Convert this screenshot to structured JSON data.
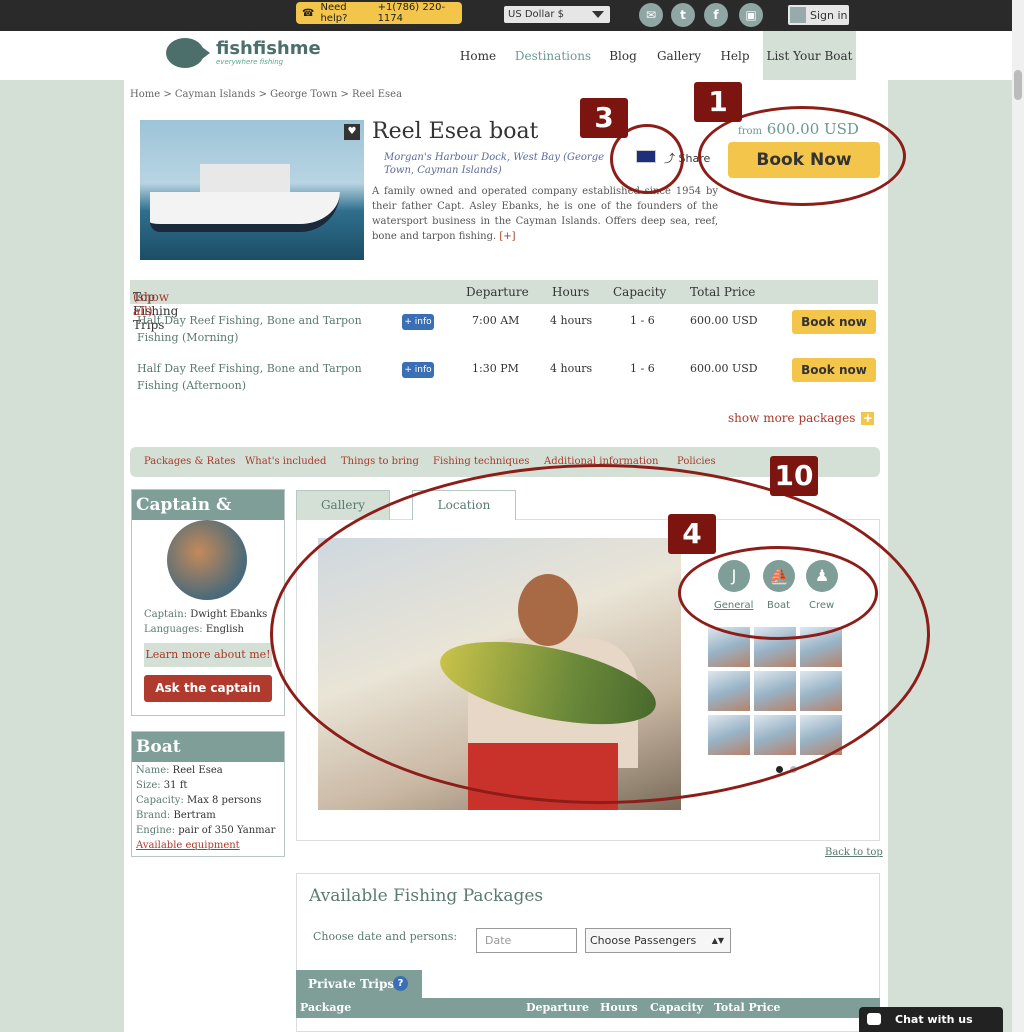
{
  "topbar": {
    "help_label": "Need help?",
    "phone": "+1(786) 220-1174",
    "currency": "US Dollar $",
    "social_icons": [
      "email-icon",
      "twitter-icon",
      "facebook-icon",
      "instagram-icon"
    ],
    "signin": "Sign in"
  },
  "header": {
    "logo_name": "fishfishme",
    "logo_tag": "everywhere fishing",
    "nav": [
      "Home",
      "Destinations",
      "Blog",
      "Gallery",
      "Help",
      "List Your Boat"
    ]
  },
  "breadcrumb": "Home > Cayman Islands > George Town > Reel Esea",
  "listing": {
    "title": "Reel Esea boat",
    "location": "Morgan's Harbour Dock, West Bay (George Town, Cayman Islands)",
    "share": "Share",
    "description": "A family owned and operated company established since 1954 by their father Capt. Asley Ebanks, he is one of the founders of the watersport business in the Cayman Islands. Offers deep sea, reef, bone and tarpon fishing.",
    "more": "[+]",
    "from_label": "from",
    "from_price": "600.00 USD",
    "book_now": "Book Now"
  },
  "trips": {
    "heading": "Top Fishing Trips",
    "show_all": "(show all)",
    "columns": [
      "Departure",
      "Hours",
      "Capacity",
      "Total Price"
    ],
    "rows": [
      {
        "name": "Half Day Reef Fishing, Bone and Tarpon Fishing (Morning)",
        "info": "+ info",
        "departure": "7:00 AM",
        "hours": "4 hours",
        "capacity": "1 - 6",
        "price": "600.00 USD",
        "button": "Book now"
      },
      {
        "name": "Half Day Reef Fishing, Bone and Tarpon Fishing (Afternoon)",
        "info": "+ info",
        "departure": "1:30 PM",
        "hours": "4 hours",
        "capacity": "1 - 6",
        "price": "600.00 USD",
        "button": "Book now"
      }
    ],
    "show_more": "show more packages"
  },
  "section_tabs": [
    "Packages & Rates",
    "What's included",
    "Things to bring",
    "Fishing techniques",
    "Additional information",
    "Policies"
  ],
  "captain": {
    "heading": "Captain & Crew",
    "captain_k": "Captain:",
    "captain_v": "Dwight Ebanks",
    "lang_k": "Languages:",
    "lang_v": "English",
    "learn": "Learn more about me!",
    "ask": "Ask the captain"
  },
  "boat": {
    "heading": "Boat",
    "fields": [
      {
        "k": "Name:",
        "v": "Reel Esea"
      },
      {
        "k": "Size:",
        "v": "31 ft"
      },
      {
        "k": "Capacity:",
        "v": "Max 8 persons"
      },
      {
        "k": "Brand:",
        "v": "Bertram"
      },
      {
        "k": "Engine:",
        "v": "pair of 350 Yanmar"
      }
    ],
    "equipment": "Available equipment"
  },
  "gallery": {
    "tabs": [
      "Gallery",
      "Location"
    ],
    "filters": [
      "General",
      "Boat",
      "Crew"
    ]
  },
  "back_to_top": "Back to top",
  "packages": {
    "heading": "Available Fishing Packages",
    "choose_label": "Choose date and persons:",
    "date_placeholder": "Date",
    "passengers": "Choose Passengers",
    "private_tab": "Private Trips",
    "columns": [
      "Package",
      "Departure",
      "Hours",
      "Capacity",
      "Total Price"
    ]
  },
  "chat": "Chat with us",
  "annotations": [
    "1",
    "3",
    "4",
    "10"
  ],
  "colors": {
    "accent": "#7f9e98",
    "button": "#f3c54a",
    "link": "#a83a2a",
    "annotation": "#8c1d18"
  }
}
